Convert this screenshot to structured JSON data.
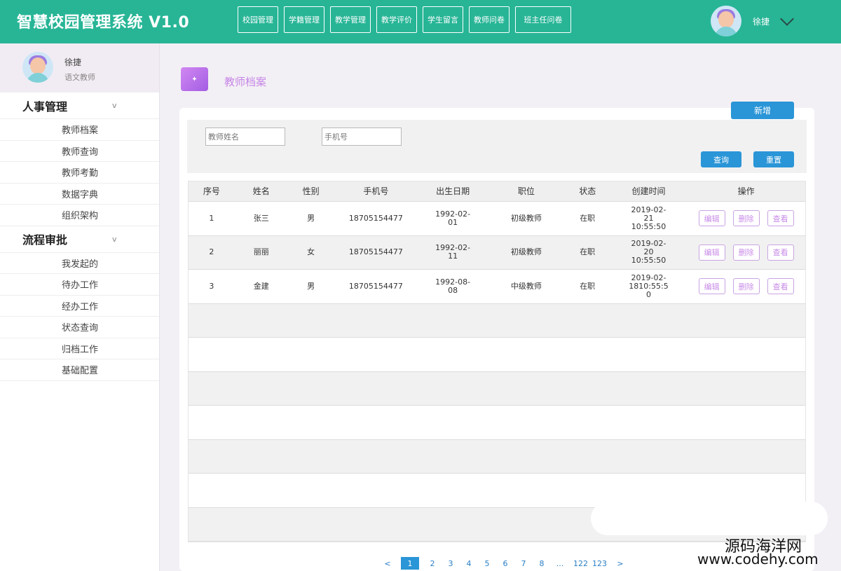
{
  "header": {
    "title": "智慧校园管理系统 V1.0",
    "nav": [
      "校园管理",
      "学籍管理",
      "教学管理",
      "教学评价",
      "学生留言",
      "教师问卷",
      "班主任问卷"
    ],
    "user_name": "徐捷"
  },
  "sidebar": {
    "profile": {
      "name": "徐捷",
      "role": "语文教师"
    },
    "groups": [
      {
        "title": "人事管理",
        "caret": "v",
        "items": [
          "教师档案",
          "教师查询",
          "教师考勤",
          "数据字典",
          "组织架构"
        ]
      },
      {
        "title": "流程审批",
        "caret": "v",
        "items": [
          "我发起的",
          "待办工作",
          "经办工作",
          "状态查询",
          "归档工作",
          "基础配置"
        ]
      }
    ]
  },
  "page": {
    "title": "教师档案",
    "add_label": "新增",
    "search": {
      "name_placeholder": "教师姓名",
      "phone_placeholder": "手机号",
      "query_label": "查询",
      "reset_label": "重置"
    }
  },
  "table": {
    "headers": [
      "序号",
      "姓名",
      "性别",
      "手机号",
      "出生日期",
      "职位",
      "状态",
      "创建时间",
      "操作"
    ],
    "rows": [
      {
        "idx": "1",
        "name": "张三",
        "gender": "男",
        "phone": "18705154477",
        "birth_1": "1992-02-",
        "birth_2": "01",
        "title": "初级教师",
        "status": "在职",
        "created_1": "2019-02-",
        "created_2": "21",
        "created_3": "10:55:50"
      },
      {
        "idx": "2",
        "name": "丽丽",
        "gender": "女",
        "phone": "18705154477",
        "birth_1": "1992-02-",
        "birth_2": "11",
        "title": "初级教师",
        "status": "在职",
        "created_1": "2019-02-",
        "created_2": "20",
        "created_3": "10:55:50"
      },
      {
        "idx": "3",
        "name": "金建",
        "gender": "男",
        "phone": "18705154477",
        "birth_1": "1992-08-",
        "birth_2": "08",
        "title": "中级教师",
        "status": "在职",
        "created_1": "2019-02-",
        "created_2": "1810:55:5",
        "created_3": "0"
      }
    ],
    "ops": {
      "edit": "编辑",
      "delete": "删除",
      "view": "查看"
    }
  },
  "pager": {
    "prev": "<",
    "pages": [
      "1",
      "2",
      "3",
      "4",
      "5",
      "6",
      "7",
      "8",
      "...",
      "122",
      "123"
    ],
    "active": "1",
    "next": ">"
  },
  "watermark": {
    "cn": "源码海洋网",
    "url": "www.codehy.com"
  },
  "colors": {
    "header_bg": "#27b596",
    "button_blue": "#2a95d7",
    "accent_purple": "#c685e6"
  }
}
